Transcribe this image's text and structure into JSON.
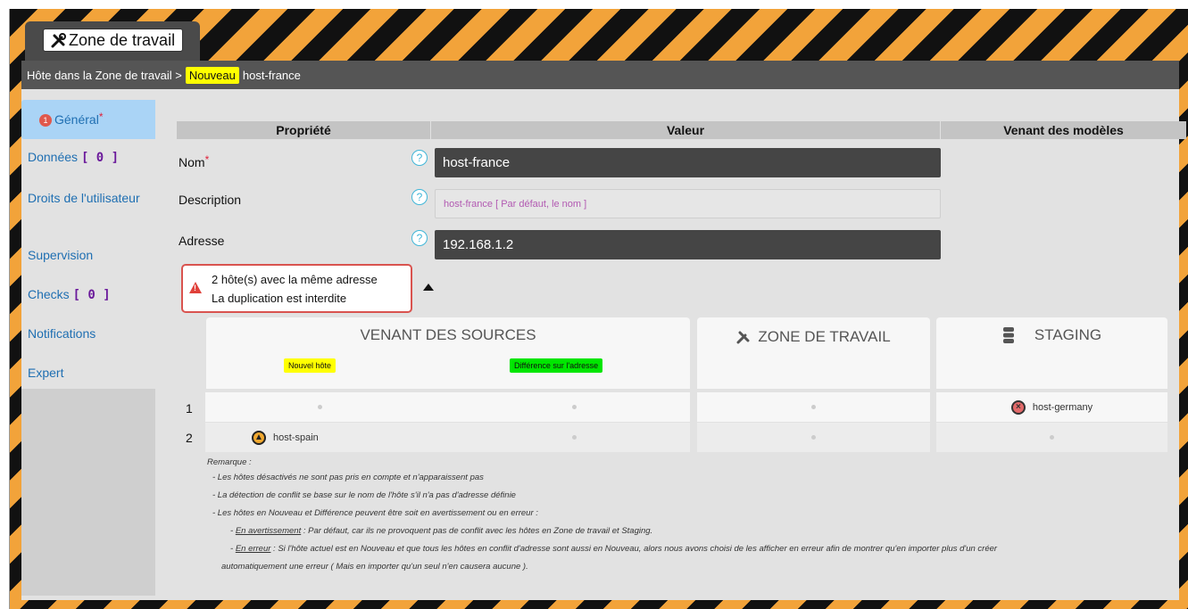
{
  "app": {
    "tab_icon": "wrench-screwdriver-icon",
    "tab_title": "Zone de travail"
  },
  "breadcrumb": {
    "prefix": "Hôte dans la Zone de travail >",
    "badge": "Nouveau",
    "host": "host-france"
  },
  "sidebar": {
    "items": [
      {
        "label": "Général",
        "count": "1",
        "required": "*"
      },
      {
        "label": "Données",
        "bracket": "[ 0 ]"
      },
      {
        "label": "Droits de l'utilisateur"
      },
      {
        "label": "Supervision"
      },
      {
        "label": "Checks",
        "bracket": "[ 0 ]"
      },
      {
        "label": "Notifications"
      },
      {
        "label": "Expert"
      }
    ]
  },
  "table_head": {
    "property": "Propriété",
    "value": "Valeur",
    "templates": "Venant des modèles"
  },
  "fields": {
    "name_label": "Nom",
    "name_required": "*",
    "name_value": "host-france",
    "description_label": "Description",
    "description_placeholder": "host-france [ Par défaut, le nom ]",
    "address_label": "Adresse",
    "address_value": "192.168.1.2",
    "help_glyph": "?"
  },
  "alert": {
    "line1": "2 hôte(s) avec la même adresse",
    "line2": "La duplication est interdite",
    "icon_glyph": "!"
  },
  "conflict": {
    "sources_title": "VENANT DES SOURCES",
    "tag_new": "Nouvel hôte",
    "tag_diff": "Différence sur l'adresse",
    "workspace_title": "ZONE DE TRAVAIL",
    "staging_title": "STAGING",
    "rows": [
      {
        "num": "1",
        "staging_host": "host-germany"
      },
      {
        "num": "2",
        "source_host": "host-spain"
      }
    ]
  },
  "remark": {
    "title": "Remarque :",
    "l1": "- Les hôtes désactivés ne sont pas pris en compte et n'apparaissent pas",
    "l2": "- La détection de conflit se base sur le nom de l'hôte s'il n'a pas d'adresse définie",
    "l3": "- Les hôtes en Nouveau et Différence peuvent être soit en avertissement ou en erreur :",
    "l4_label": "En avertissement",
    "l4_text": " : Par défaut, car ils ne provoquent pas de conflit avec les hôtes en Zone de travail et Staging.",
    "l5_label": "En erreur",
    "l5_text": " : Si l'hôte actuel est en Nouveau et que tous les hôtes en conflit d'adresse sont aussi en Nouveau, alors nous avons choisi de les afficher en erreur afin de montrer qu'en importer plus d'un créer",
    "l6": "automatiquement une erreur ( Mais en importer qu'un seul n'en causera aucune )."
  }
}
